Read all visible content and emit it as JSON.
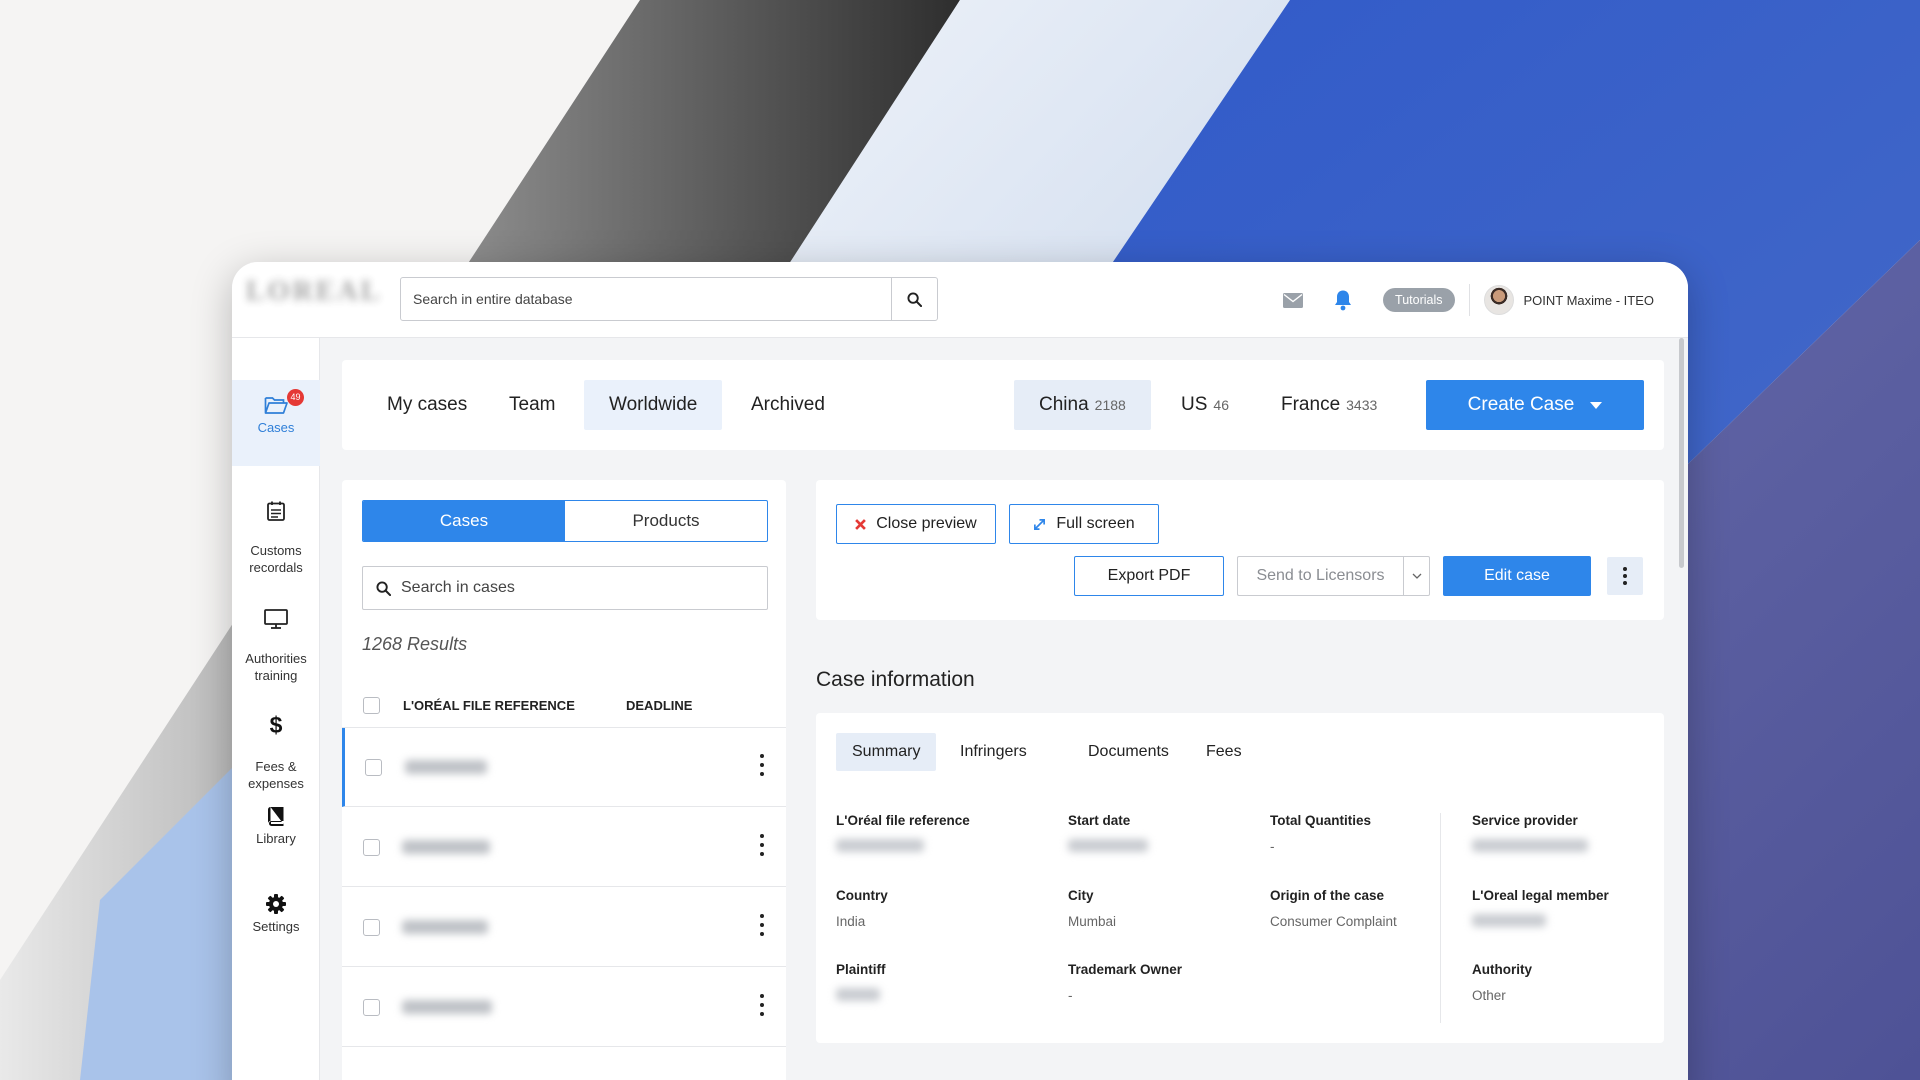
{
  "header": {
    "search_placeholder": "Search in entire database",
    "tutorials_label": "Tutorials",
    "user_name": "POINT Maxime - ITEO"
  },
  "sidebar": {
    "items": [
      {
        "label": "Cases",
        "icon": "folder-open-icon",
        "badge": "49",
        "active": true
      },
      {
        "label": "Customs\nrecordals",
        "icon": "calendar-list-icon"
      },
      {
        "label": "Authorities\ntraining",
        "icon": "monitor-icon"
      },
      {
        "label": "Fees &\nexpenses",
        "icon": "dollar-icon"
      },
      {
        "label": "Library",
        "icon": "book-icon"
      },
      {
        "label": "Settings",
        "icon": "gear-icon"
      }
    ]
  },
  "scope_tabs": [
    {
      "label": "My cases"
    },
    {
      "label": "Team"
    },
    {
      "label": "Worldwide",
      "active": true
    },
    {
      "label": "Archived"
    }
  ],
  "countries": [
    {
      "name": "China",
      "count": "2188",
      "active": true
    },
    {
      "name": "US",
      "count": "46"
    },
    {
      "name": "France",
      "count": "3433"
    }
  ],
  "create_case_label": "Create Case",
  "list": {
    "segment": {
      "cases": "Cases",
      "products": "Products",
      "active": "Cases"
    },
    "search_placeholder": "Search in cases",
    "results": "1268 Results",
    "columns": {
      "ref": "L'ORÉAL FILE REFERENCE",
      "deadline": "DEADLINE"
    }
  },
  "preview_actions": {
    "close_preview": "Close preview",
    "full_screen": "Full screen",
    "export_pdf": "Export PDF",
    "send_to_licensors": "Send to Licensors",
    "edit_case": "Edit case"
  },
  "case_information": {
    "title": "Case information",
    "tabs": [
      "Summary",
      "Infringers",
      "Documents",
      "Fees"
    ],
    "active_tab": "Summary",
    "fields": {
      "file_reference": {
        "label": "L'Oréal file reference"
      },
      "start_date": {
        "label": "Start date"
      },
      "total_quantities": {
        "label": "Total Quantities",
        "value": "-"
      },
      "service_provider": {
        "label": "Service provider"
      },
      "country": {
        "label": "Country",
        "value": "India"
      },
      "city": {
        "label": "City",
        "value": "Mumbai"
      },
      "origin": {
        "label": "Origin of the case",
        "value": "Consumer Complaint"
      },
      "legal_member": {
        "label": "L'Oreal legal member"
      },
      "plaintiff": {
        "label": "Plaintiff"
      },
      "trademark_owner": {
        "label": "Trademark Owner",
        "value": "-"
      },
      "authority": {
        "label": "Authority",
        "value": "Other"
      }
    }
  },
  "colors": {
    "accent": "#2e86ea",
    "badge": "#e53935",
    "bg_blue": "#3a5fc0",
    "bg_violet": "#5a5c9e"
  }
}
